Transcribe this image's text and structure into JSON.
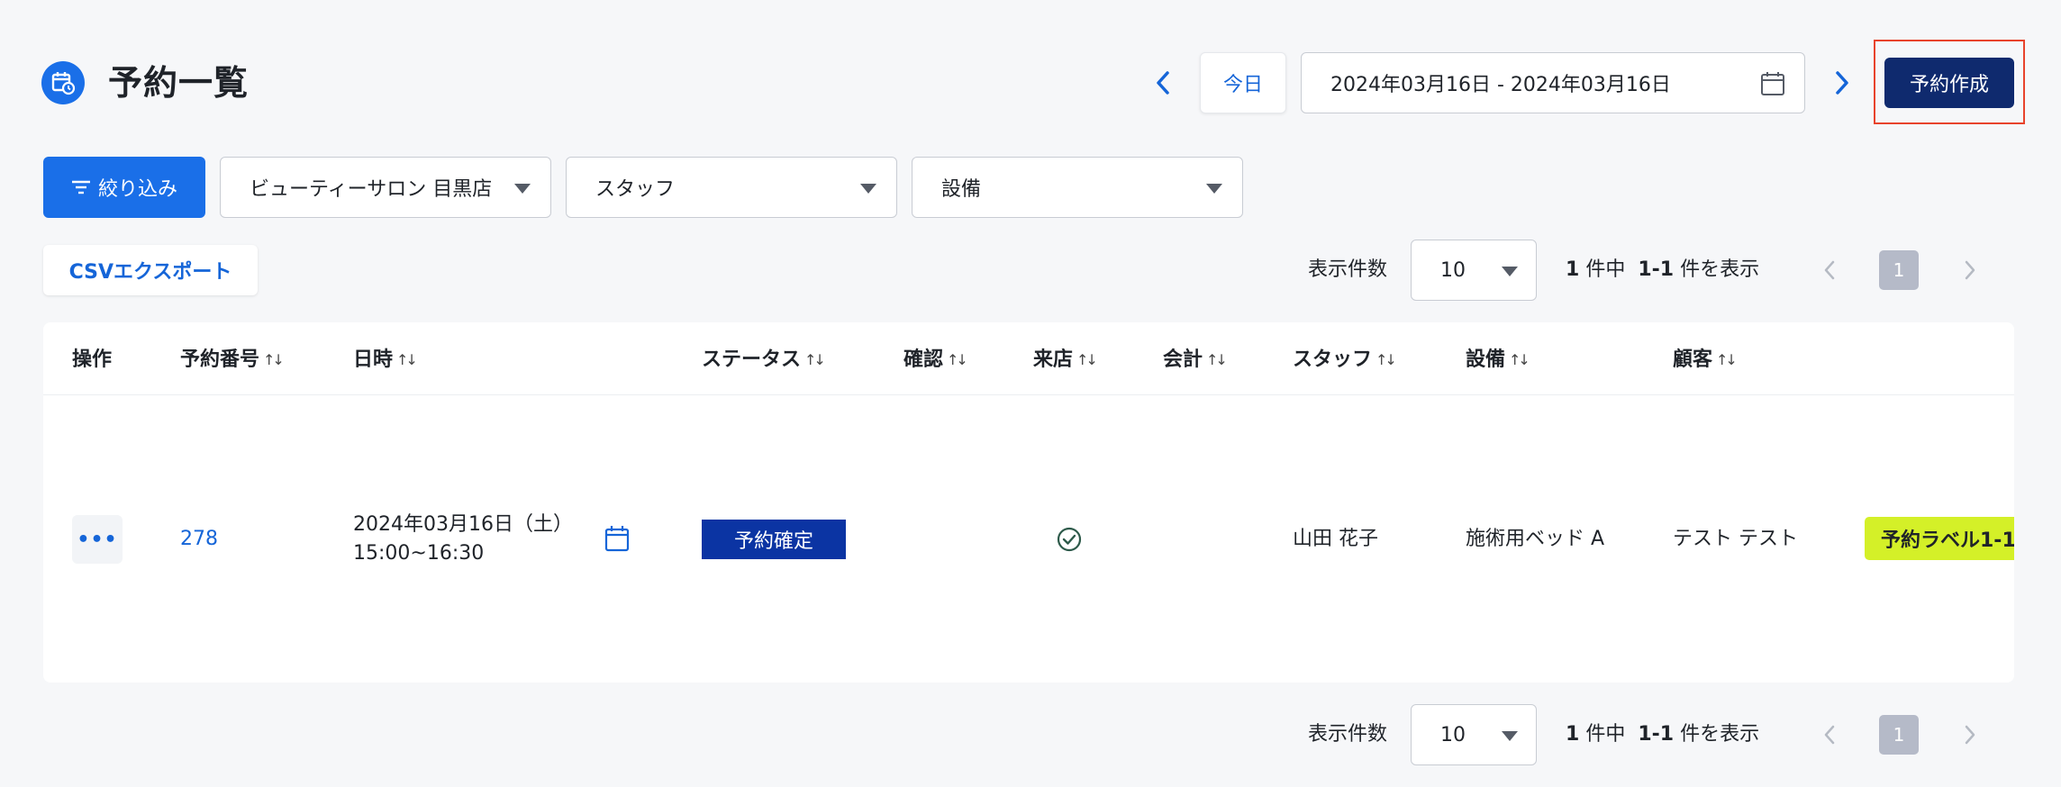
{
  "header": {
    "title": "予約一覧",
    "today_label": "今日",
    "date_range": "2024年03月16日 - 2024年03月16日",
    "create_label": "予約作成"
  },
  "filters": {
    "filter_label": "絞り込み",
    "store": "ビューティーサロン 目黒店",
    "staff_placeholder": "スタッフ",
    "equipment_placeholder": "設備"
  },
  "export": {
    "csv_label": "CSVエクスポート"
  },
  "pagination": {
    "per_page_label": "表示件数",
    "per_page": "10",
    "total": "1",
    "total_suffix": "件中",
    "range": "1-1",
    "range_suffix": "件を表示",
    "current_page": "1"
  },
  "table": {
    "columns": [
      "操作",
      "予約番号",
      "日時",
      "ステータス",
      "確認",
      "来店",
      "会計",
      "スタッフ",
      "設備",
      "顧客"
    ],
    "rows": [
      {
        "number": "278",
        "date": "2024年03月16日（土）",
        "time": "15:00~16:30",
        "status": "予約確定",
        "visited": true,
        "staff": "山田 花子",
        "equipment": "施術用ベッド A",
        "customer": "テスト テスト",
        "label": "予約ラベル1-1"
      }
    ]
  },
  "colors": {
    "primary": "#1a6fe8",
    "navy": "#0f2a6e",
    "status_bg": "#0b34a3",
    "label_bg": "#d4f028",
    "highlight": "#e8432c"
  }
}
